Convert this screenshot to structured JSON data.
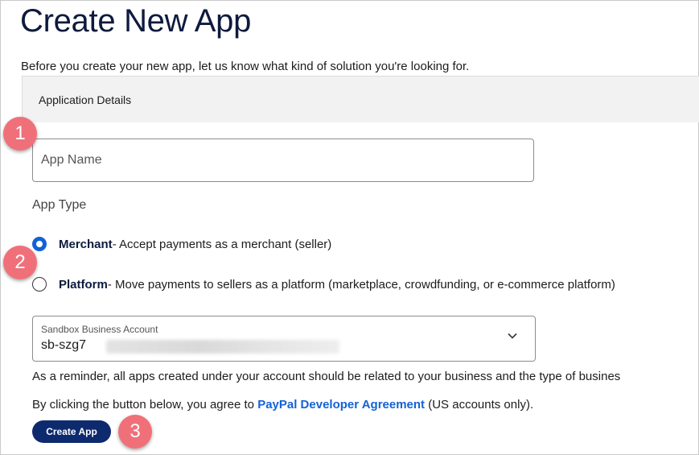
{
  "page": {
    "title": "Create New App",
    "intro": "Before you create your new app, let us know what kind of solution you're looking for."
  },
  "section": {
    "title": "Application Details"
  },
  "form": {
    "app_name_placeholder": "App Name",
    "app_type_label": "App Type",
    "options": [
      {
        "title": "Merchant",
        "description": " - Accept payments as a merchant (seller)",
        "selected": true
      },
      {
        "title": "Platform",
        "description": " - Move payments to sellers as a platform (marketplace, crowdfunding, or e-commerce platform)",
        "selected": false
      }
    ],
    "sandbox": {
      "label": "Sandbox Business Account",
      "value": "sb-szg7"
    },
    "reminder": "As a reminder, all apps created under your account should be related to your business and the type of busines",
    "agree_prefix": "By clicking the button below, you agree to ",
    "agree_link": "PayPal Developer Agreement",
    "agree_suffix": " (US accounts only).",
    "create_button": "Create App"
  },
  "markers": [
    "1",
    "2",
    "3"
  ],
  "colors": {
    "accent": "#1262d6",
    "button": "#0e2a6f",
    "marker": "#f0707a",
    "title": "#0e1a3e"
  }
}
